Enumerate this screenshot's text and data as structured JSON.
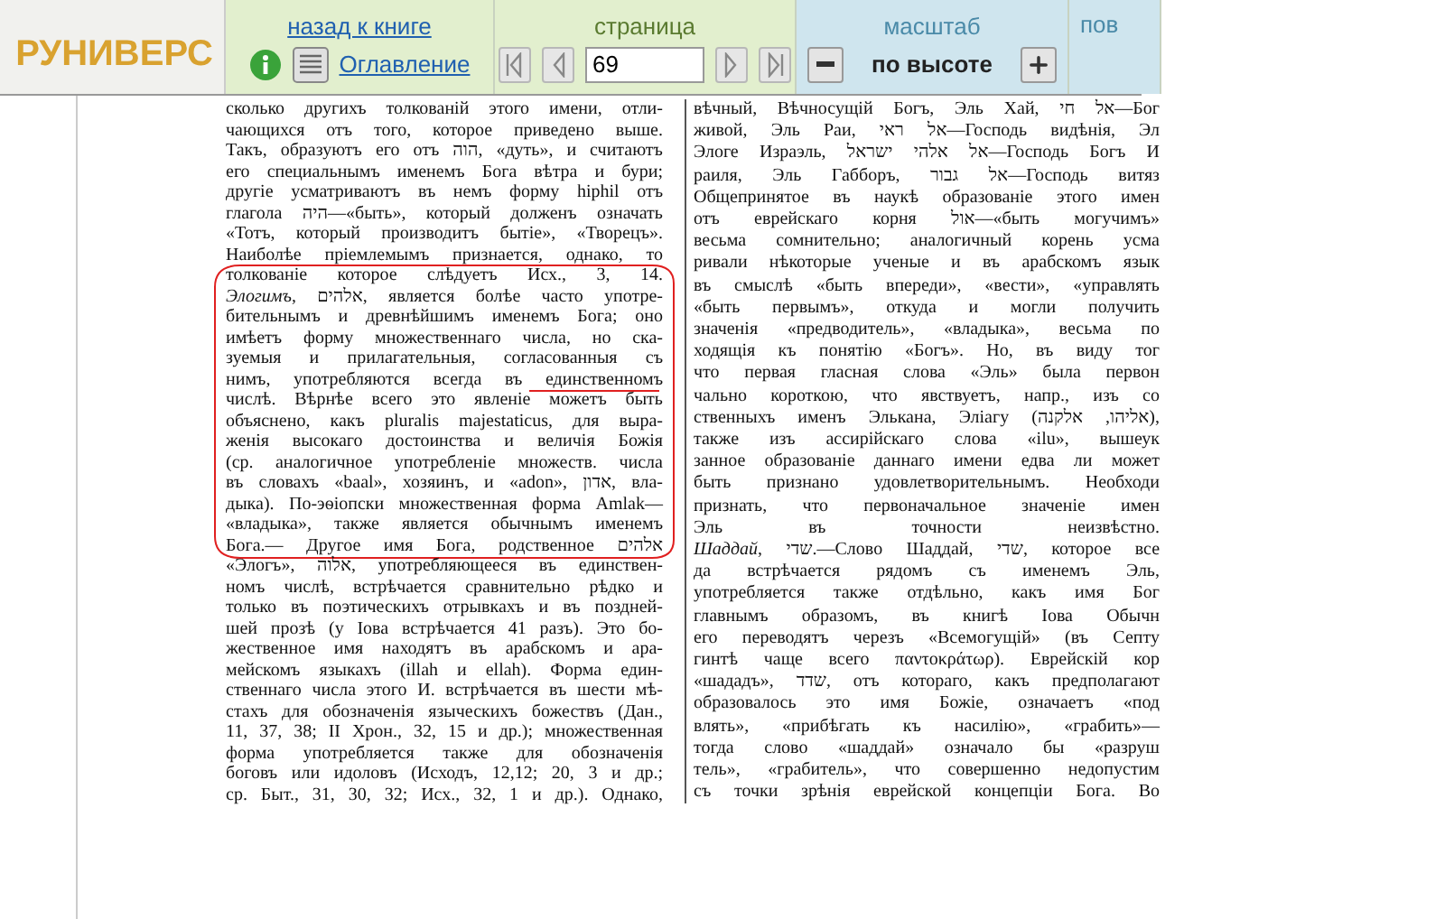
{
  "logo": {
    "text": "РУНИВЕРС"
  },
  "nav": {
    "back_link": "назад к книге",
    "contents_link": "Оглавление"
  },
  "pager": {
    "title": "страница",
    "page": "69"
  },
  "scale": {
    "title": "масштаб",
    "mode": "по высоте"
  },
  "cut_section": {
    "title": "пов"
  },
  "document": {
    "left_column": [
      "сколько другихъ толкованій этого имени, отли-",
      "чающихся отъ того, которое приведено выше.",
      "Такъ, образуютъ его отъ הוה, «дуть», и считаютъ",
      "его специальнымъ именемъ Бога вѣтра и бури;",
      "другіе усматриваютъ въ немъ форму hiphil отъ",
      "глагола היה—«быть», который долженъ означать",
      "«Тотъ, который производитъ бытіе», «Творецъ».",
      "Наиболѣе пріемлемымъ признается, однако, то",
      "толкованіе которое слѣдуетъ Исх., 3, 14.",
      "*Элогимъ*, אלהים, является болѣе часто употре-",
      "бительнымъ и древнѣйшимъ именемъ Бога; оно",
      "имѣетъ форму множественнаго числа, но ска-",
      "зуемыя и прилагательныя, согласованныя съ",
      "нимъ, употребляются всегда въ единственномъ",
      "числѣ. Вѣрнѣе всего это явленіе можетъ быть",
      "объяснено, какъ pluralis majestaticus, для выра-",
      "женія высокаго достоинства и величія Божія",
      "(ср. аналогичное употребленіе множеств. числа",
      "въ словахъ «baal», хозяинъ, и «adon», אדון, вла-",
      "дыка). По-эѳіопски множественная форма Amlak—",
      "«владыка», также является обычнымъ именемъ",
      "Бога.— Другое имя Бога, родственное אלהים",
      "«Элогъ», אלוה, употребляющееся въ единствен-",
      "номъ числѣ, встрѣчается сравнительно рѣдко и",
      "только въ поэтическихъ отрывкахъ и въ поздней-",
      "шей прозѣ (у Іова встрѣчается 41 разъ). Это бо-",
      "жественное имя находятъ въ арабскомъ и ара-",
      "мейскомъ языкахъ (illah и ellah). Форма един-",
      "ственнаго числа этого И. встрѣчается въ шести мѣ-",
      "стахъ для обозначенія языческихъ божествъ (Дан.,",
      "11, 37, 38; II Хрон., 32, 15 и др.); множественная",
      "форма употребляется также для обозначенія",
      "боговъ или идоловъ (Исходъ, 12,12; 20, 3 и др.;",
      "ср. Быт., 31, 30, 32; Исх., 32, 1 и др.). Однако,"
    ],
    "right_column": [
      "вѣчный, Вѣчносущій Богъ, Эль Хай, אל חי—Бог",
      "живой, Эль Раи, אל ראי—Господь видѣнія, Эл",
      "Элоге Израэль, אל אלהי ישראל—Господь Богъ И",
      "раиля, Эль Габборъ, אל גבור—Господь витяз",
      "Общепринятое въ наукѣ образованіе этого имен",
      "отъ еврейскаго корня אול—«быть могучимъ»",
      "весьма сомнительно; аналогичный корень усма",
      "ривали нѣкоторые ученые и въ арабскомъ язык",
      "въ смыслѣ «быть впереди», «вести», «управлять",
      "«быть первымъ», откуда и могли получить",
      "значенія «предводитель», «владыка», весьма по",
      "ходящія къ понятію «Богъ». Но, въ виду тог",
      "что первая гласная слова «Эль» была первон",
      "чально короткою, что явствуетъ, напр., изъ со",
      "ственныхъ именъ Элькана, Эліагу (אליהו, אלקנה),",
      "также изъ ассирійскаго слова «ilu», вышеук",
      "занное образованіе даннаго имени едва ли может",
      "быть признано удовлетворительнымъ. Необходи",
      "признать, что первоначальное значеніе имен",
      "Эль въ точности неизвѣстно.",
      "*Шаддай*, שדי.—Слово Шаддай, שדי, которое все",
      "да встрѣчается рядомъ съ именемъ Эль,",
      "употребляется также отдѣльно, какъ имя Бог",
      "главнымъ образомъ, въ книгѣ Іова Обычн",
      "его переводятъ черезъ «Всемогущій» (въ Септу",
      "гинтѣ чаще всего παντοκράτωρ). Еврейскій кор",
      "«шададъ», שדד, отъ котораго, какъ предполагают",
      "образовалось это имя Божіе, означаетъ «под",
      "влять», «прибѣгать къ насилію», «грабить»—",
      "тогда слово «шаддай» означало бы «разруш",
      "тель», «грабитель», что совершенно недопустим",
      "съ точки зрѣнія еврейской концепціи Бога. Во"
    ]
  }
}
